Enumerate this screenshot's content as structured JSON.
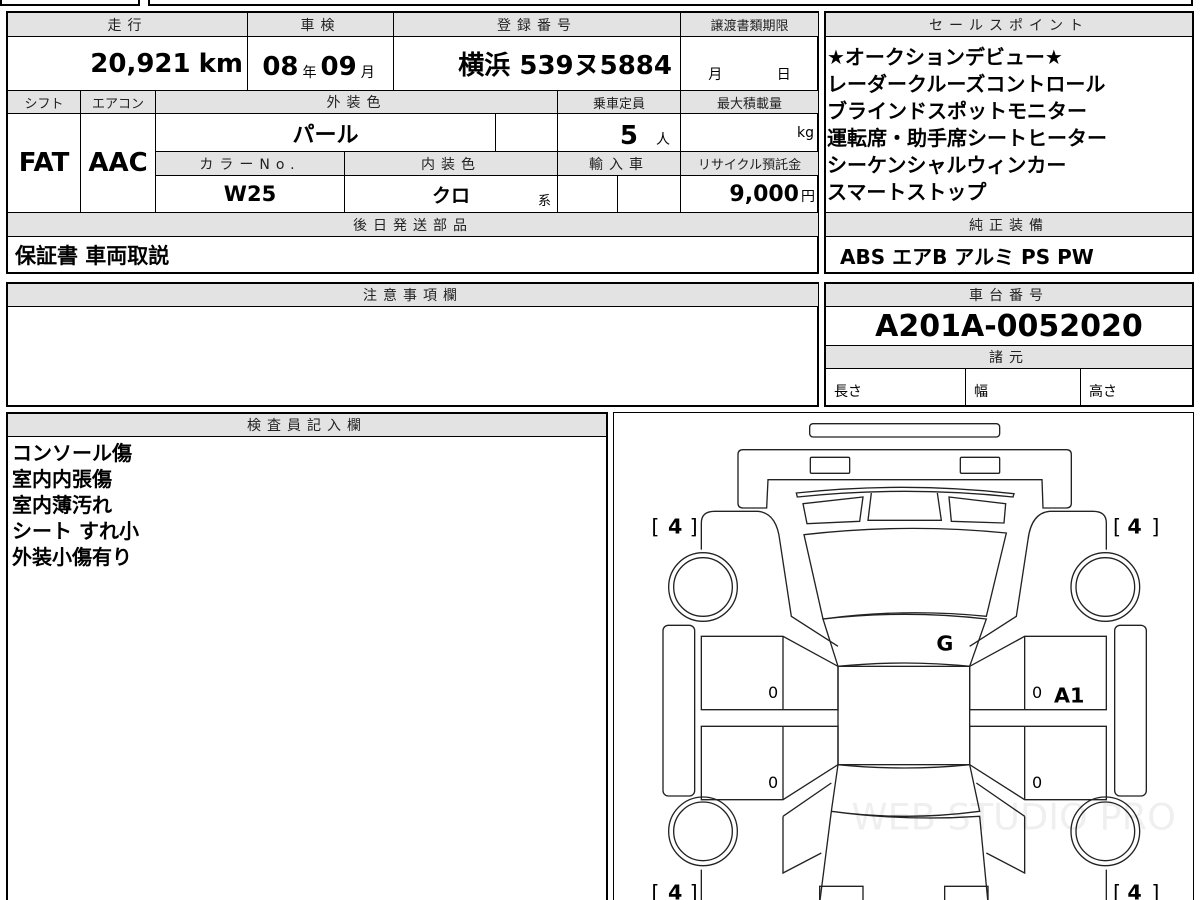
{
  "vehicle": {
    "mileage_label": "走行",
    "mileage": "20,921",
    "mileage_unit": "km",
    "inspection_label": "車検",
    "inspection_year": "08",
    "year_unit": "年",
    "inspection_month": "09",
    "month_unit": "月",
    "registration_label": "登録番号",
    "registration": "横浜 539ヌ5884",
    "transfer_deadline_label": "譲渡書類期限",
    "deadline_month_unit": "月",
    "deadline_day_unit": "日",
    "shift_label": "シフト",
    "shift": "FAT",
    "ac_label": "エアコン",
    "ac": "AAC",
    "exterior_color_label": "外装色",
    "exterior_color": "パール",
    "capacity_label": "乗車定員",
    "capacity": "5",
    "capacity_unit": "人",
    "max_load_label": "最大積載量",
    "max_load_unit": "kg",
    "color_no_label": "カラーNo.",
    "color_no": "W25",
    "interior_color_label": "内装色",
    "interior_color": "クロ",
    "interior_suffix": "系",
    "import_label": "輸入車",
    "recycle_label": "リサイクル預託金",
    "recycle_fee": "9,000",
    "recycle_unit": "円",
    "later_parts_label": "後日発送部品",
    "later_parts": "保証書 車両取説"
  },
  "sales_points": {
    "label": "セールスポイント",
    "items": [
      "★オークションデビュー★",
      "レーダークルーズコントロール",
      "ブラインドスポットモニター",
      "運転席・助手席シートヒーター",
      "シーケンシャルウィンカー",
      "スマートストップ"
    ]
  },
  "equipment": {
    "label": "純正装備",
    "value": "ABS エアB アルミ PS PW"
  },
  "notes": {
    "label": "注意事項欄"
  },
  "chassis": {
    "label": "車台番号",
    "value": "A201A-0052020",
    "specs_label": "諸元",
    "length": "長さ",
    "width": "幅",
    "height": "高さ"
  },
  "inspector": {
    "label": "検査員記入欄",
    "items": [
      "コンソール傷",
      "室内内張傷",
      "室内薄汚れ",
      "シート すれ小",
      "外装小傷有り"
    ]
  },
  "diagram": {
    "tires": [
      "4",
      "4",
      "4",
      "4"
    ],
    "marks": {
      "g": "G",
      "a1": "A1",
      "z1": "0",
      "z2": "0",
      "z3": "0",
      "z4": "0"
    },
    "watermark": "WEB STUDIO PRO"
  }
}
